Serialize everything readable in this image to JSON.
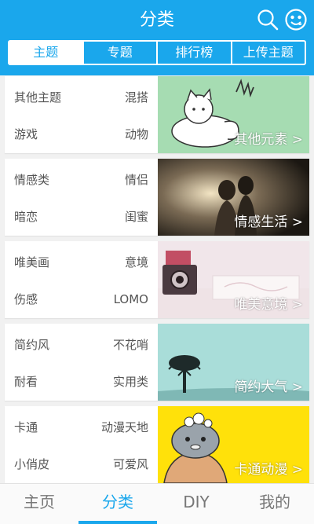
{
  "header": {
    "title": "分类",
    "search_icon": "search-icon",
    "face_icon": "smile-face-icon",
    "bg_color": "#1aa7ec"
  },
  "tabs": [
    {
      "label": "主题",
      "active": true
    },
    {
      "label": "专题",
      "active": false
    },
    {
      "label": "排行榜",
      "active": false
    },
    {
      "label": "上传主题",
      "active": false
    }
  ],
  "categories": [
    {
      "tags": [
        "其他主题",
        "混搭",
        "游戏",
        "动物"
      ],
      "label": "其他元素 >"
    },
    {
      "tags": [
        "情感类",
        "情侣",
        "暗恋",
        "闺蜜"
      ],
      "label": "情感生活 >"
    },
    {
      "tags": [
        "唯美画",
        "意境",
        "伤感",
        "LOMO"
      ],
      "label": "唯美意境 >"
    },
    {
      "tags": [
        "简约风",
        "不花哨",
        "耐看",
        "实用类"
      ],
      "label": "简约大气 >"
    },
    {
      "tags": [
        "卡通",
        "动漫天地",
        "小俏皮",
        "可爱风"
      ],
      "label": "卡通动漫 >"
    }
  ],
  "bottom_nav": [
    {
      "label": "主页",
      "active": false
    },
    {
      "label": "分类",
      "active": true
    },
    {
      "label": "DIY",
      "active": false
    },
    {
      "label": "我的",
      "active": false
    }
  ],
  "accent_color": "#1aa7ec"
}
